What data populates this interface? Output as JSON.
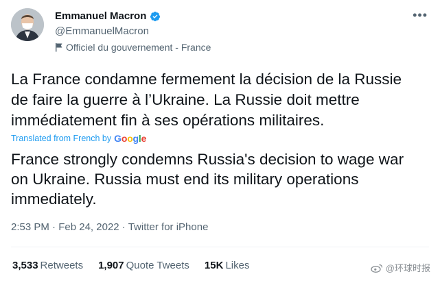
{
  "tweet": {
    "author_name": "Emmanuel Macron",
    "handle": "@EmmanuelMacron",
    "label": "Officiel du gouvernement - France",
    "text": "La France condamne fermement la décision de la Russie de faire la guerre à l’Ukraine. La Russie doit mettre immédiatement fin à ses opérations militaires.",
    "translated_from": "Translated from French by",
    "translator": [
      "G",
      "o",
      "o",
      "g",
      "l",
      "e"
    ],
    "translation": "France strongly condemns Russia's decision to wage war on Ukraine. Russia must end its military operations immediately.",
    "time": "2:53 PM",
    "date": "Feb 24, 2022",
    "source": "Twitter for iPhone",
    "separator": "·",
    "more_label": "•••"
  },
  "stats": {
    "retweets_count": "3,533",
    "retweets_label": "Retweets",
    "quotes_count": "1,907",
    "quotes_label": "Quote Tweets",
    "likes_count": "15K",
    "likes_label": "Likes"
  },
  "watermark": {
    "text": "@环球时报"
  },
  "colors": {
    "text": "#0f1419",
    "secondary": "#536471",
    "link": "#1d9bf0",
    "verified": "#1d9bf0"
  }
}
